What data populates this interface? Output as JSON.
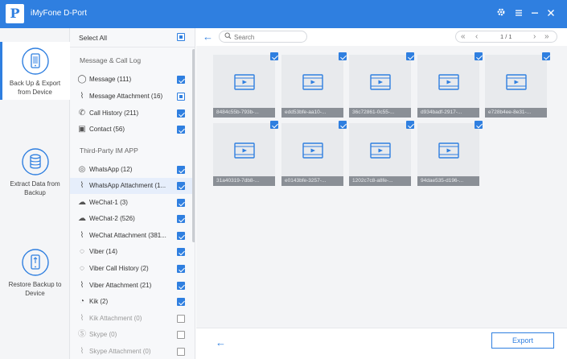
{
  "app": {
    "title": "iMyFone D-Port",
    "logo_letter": "P",
    "accent": "#2f7fe0"
  },
  "nav": [
    {
      "label": "Back Up & Export from Device",
      "icon": "phone-export-icon",
      "active": true
    },
    {
      "label": "Extract Data from Backup",
      "icon": "database-icon",
      "active": false
    },
    {
      "label": "Restore Backup to Device",
      "icon": "phone-restore-icon",
      "active": false
    }
  ],
  "categories": {
    "select_all": "Select All",
    "section1": "Message & Call Log",
    "section2": "Third-Party IM APP",
    "items1": [
      {
        "label": "Message (111)",
        "icon": "message-icon",
        "state": "checked"
      },
      {
        "label": "Message Attachment (16)",
        "icon": "attachment-icon",
        "state": "partial"
      },
      {
        "label": "Call History (211)",
        "icon": "phone-icon",
        "state": "checked"
      },
      {
        "label": "Contact (56)",
        "icon": "contact-icon",
        "state": "checked"
      }
    ],
    "items2": [
      {
        "label": "WhatsApp (12)",
        "icon": "whatsapp-icon",
        "state": "checked"
      },
      {
        "label": "WhatsApp Attachment (1...",
        "icon": "attachment-icon",
        "state": "checked",
        "selected": true
      },
      {
        "label": "WeChat-1 (3)",
        "icon": "wechat-icon",
        "state": "checked"
      },
      {
        "label": "WeChat-2 (526)",
        "icon": "wechat-icon",
        "state": "checked"
      },
      {
        "label": "WeChat Attachment (381...",
        "icon": "attachment-icon",
        "state": "checked"
      },
      {
        "label": "Viber (14)",
        "icon": "viber-icon",
        "state": "checked"
      },
      {
        "label": "Viber Call History (2)",
        "icon": "viber-icon",
        "state": "checked"
      },
      {
        "label": "Viber Attachment (21)",
        "icon": "attachment-icon",
        "state": "checked"
      },
      {
        "label": "Kik (2)",
        "icon": "kik-icon",
        "state": "checked"
      },
      {
        "label": "Kik Attachment (0)",
        "icon": "attachment-icon",
        "state": "empty",
        "disabled": true
      },
      {
        "label": "Skype (0)",
        "icon": "skype-icon",
        "state": "empty",
        "disabled": true
      },
      {
        "label": "Skype Attachment (0)",
        "icon": "attachment-icon",
        "state": "empty",
        "disabled": true
      }
    ]
  },
  "toolbar": {
    "search_placeholder": "Search",
    "page_text": "1 / 1"
  },
  "thumbs": [
    {
      "caption": "8484c55b-793b-..."
    },
    {
      "caption": "edd53bfe-aa10-..."
    },
    {
      "caption": "36c72861-0c55-..."
    },
    {
      "caption": "d934badf-2917-..."
    },
    {
      "caption": "e728b4ee-8e31-..."
    },
    {
      "caption": "31a40319-7db8-..."
    },
    {
      "caption": "e0143bfe-3257-..."
    },
    {
      "caption": "1202c7c8-a8fe-..."
    },
    {
      "caption": "94dae535-d196-..."
    }
  ],
  "bottom": {
    "export_label": "Export"
  }
}
